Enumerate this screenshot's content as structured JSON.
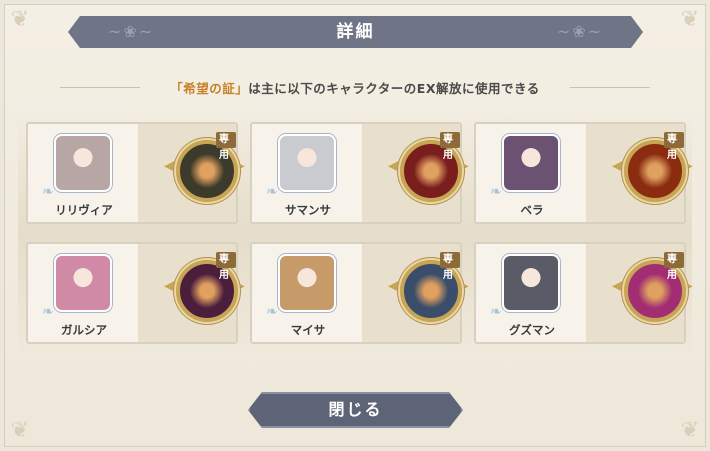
{
  "dialog": {
    "title": "詳細",
    "subtitle_highlight": "「希望の証」",
    "subtitle_rest": "は主に以下のキャラクターのEX解放に使用できる",
    "close_label": "閉じる"
  },
  "cards": [
    {
      "name": "リリヴィア",
      "badge": "専用",
      "portrait_color": "#b7a6a3",
      "medal_color": "#3c3a2a"
    },
    {
      "name": "サマンサ",
      "badge": "専用",
      "portrait_color": "#c9cbd0",
      "medal_color": "#7a1d1d"
    },
    {
      "name": "ベラ",
      "badge": "専用",
      "portrait_color": "#6b5272",
      "medal_color": "#8b2c10"
    },
    {
      "name": "ガルシア",
      "badge": "専用",
      "portrait_color": "#d18aa6",
      "medal_color": "#4b1e3c"
    },
    {
      "name": "マイサ",
      "badge": "専用",
      "portrait_color": "#c79a6a",
      "medal_color": "#3a4d6a"
    },
    {
      "name": "グズマン",
      "badge": "専用",
      "portrait_color": "#595c66",
      "medal_color": "#a12d72"
    }
  ]
}
